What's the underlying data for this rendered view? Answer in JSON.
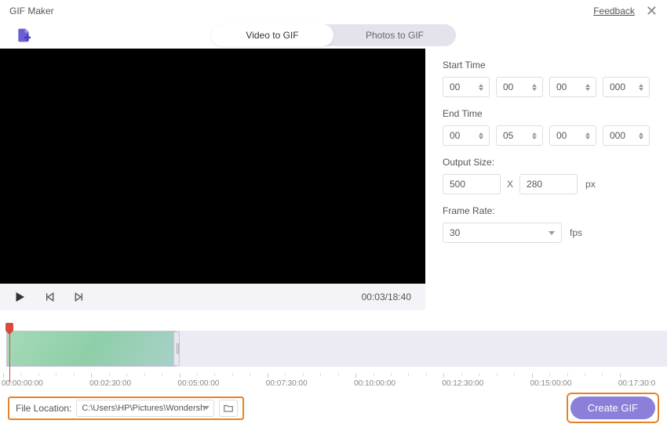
{
  "titlebar": {
    "title": "GIF Maker",
    "feedback": "Feedback"
  },
  "tabs": {
    "video": "Video to GIF",
    "photos": "Photos to GIF"
  },
  "settings": {
    "start_label": "Start Time",
    "end_label": "End Time",
    "output_size_label": "Output Size:",
    "frame_rate_label": "Frame Rate:",
    "start": {
      "h": "00",
      "m": "00",
      "s": "00",
      "ms": "000"
    },
    "end": {
      "h": "00",
      "m": "05",
      "s": "00",
      "ms": "000"
    },
    "width": "500",
    "height": "280",
    "px": "px",
    "frame_rate": "30",
    "fps": "fps",
    "x": "X"
  },
  "playback": {
    "time": "00:03/18:40"
  },
  "ruler": [
    "00:00:00:00",
    "00:02:30:00",
    "00:05:00:00",
    "00:07:30:00",
    "00:10:00:00",
    "00:12:30:00",
    "00:15:00:00",
    "00:17:30:0"
  ],
  "footer": {
    "file_location_label": "File Location:",
    "file_path": "C:\\Users\\HP\\Pictures\\Wondersh",
    "create": "Create GIF"
  },
  "colors": {
    "accent": "#8b7fd9",
    "highlight": "#e8822a"
  }
}
